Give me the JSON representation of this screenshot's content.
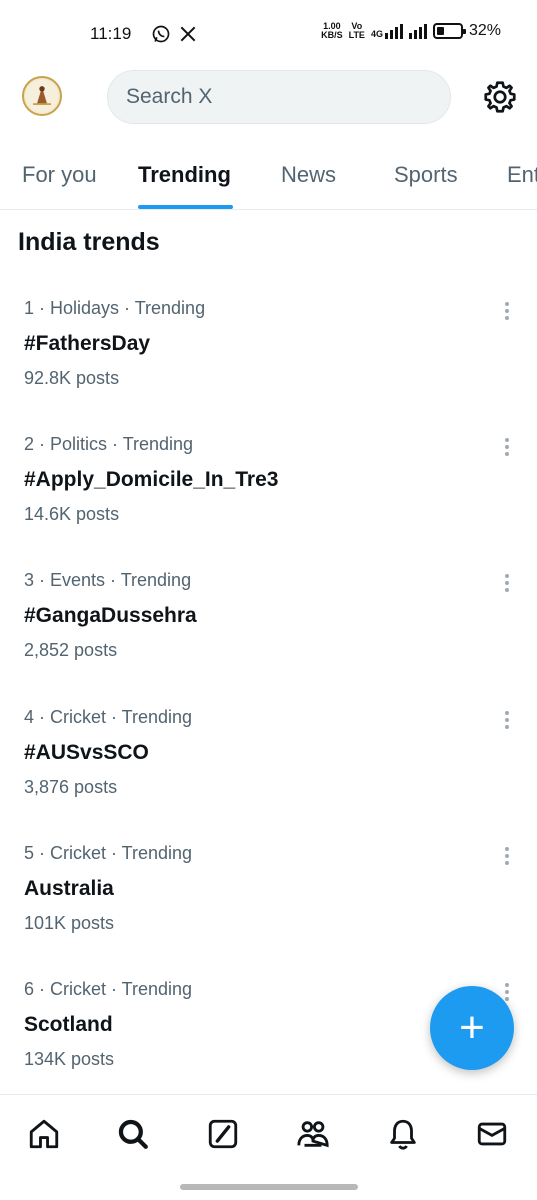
{
  "status": {
    "time": "11:19",
    "net_speed_value": "1.00",
    "net_speed_unit": "KB/S",
    "volte_top": "Vo",
    "volte_bottom": "LTE",
    "network": "4G",
    "battery_percent": "32%",
    "battery_level": 0.32
  },
  "header": {
    "search_placeholder": "Search X"
  },
  "tabs": [
    {
      "label": "For you"
    },
    {
      "label": "Trending"
    },
    {
      "label": "News"
    },
    {
      "label": "Sports"
    },
    {
      "label": "Ent"
    }
  ],
  "section": {
    "title": "India trends"
  },
  "trends": [
    {
      "meta": "1 · Holidays · Trending",
      "name": "#FathersDay",
      "count": "92.8K posts"
    },
    {
      "meta": "2 · Politics · Trending",
      "name": "#Apply_Domicile_In_Tre3",
      "count": "14.6K posts"
    },
    {
      "meta": "3 · Events · Trending",
      "name": "#GangaDussehra",
      "count": "2,852 posts"
    },
    {
      "meta": "4 · Cricket · Trending",
      "name": "#AUSvsSCO",
      "count": "3,876 posts"
    },
    {
      "meta": "5 · Cricket · Trending",
      "name": "Australia",
      "count": "101K posts"
    },
    {
      "meta": "6 · Cricket · Trending",
      "name": "Scotland",
      "count": "134K posts"
    }
  ],
  "fab": {
    "symbol": "+"
  },
  "nav": [
    {
      "icon": "home-icon"
    },
    {
      "icon": "search-icon"
    },
    {
      "icon": "grok-icon"
    },
    {
      "icon": "communities-icon"
    },
    {
      "icon": "notifications-icon"
    },
    {
      "icon": "messages-icon"
    }
  ],
  "colors": {
    "accent": "#1d9bf0",
    "text_primary": "#0f1419",
    "text_secondary": "#536471"
  }
}
